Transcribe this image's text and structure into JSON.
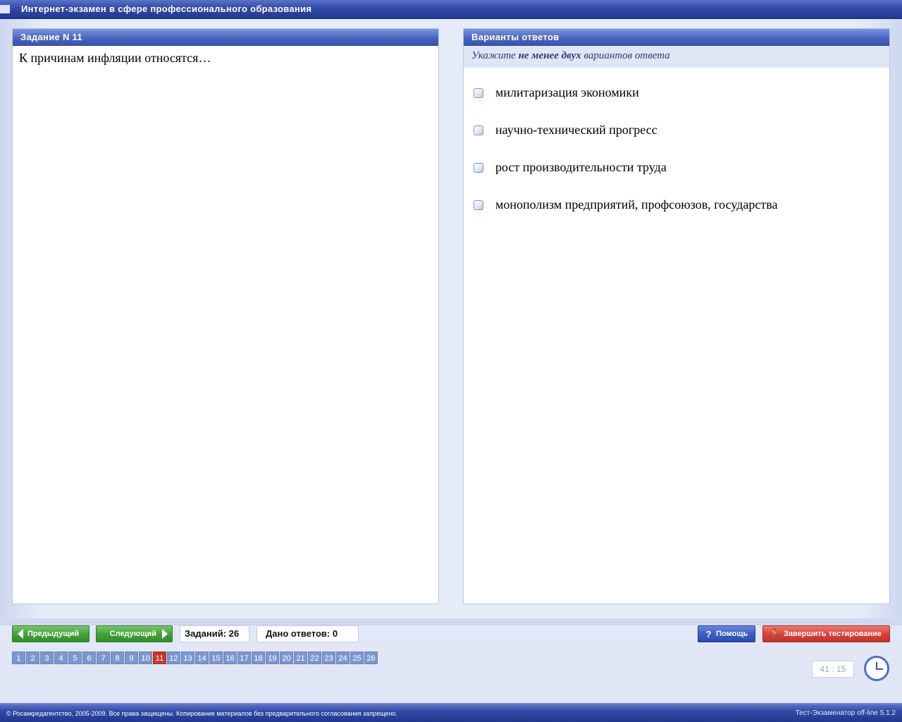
{
  "window": {
    "title": "Интернет-экзамен в сфере профессионального образования"
  },
  "task": {
    "header": "Задание N 11",
    "question": "К причинам инфляции относятся…"
  },
  "answers": {
    "header": "Варианты ответов",
    "hint_prefix": "Укажите ",
    "hint_bold": "не менее двух",
    "hint_suffix": " вариантов ответа",
    "options": [
      "милитаризация экономики",
      "научно-технический прогресс",
      "рост производительности труда",
      "монополизм предприятий, профсоюзов, государства"
    ]
  },
  "nav": {
    "prev_label": "Предыдущий",
    "next_label": "Следующий",
    "tasks_count": "Заданий: 26",
    "answers_given": "Дано ответов: 0",
    "help_label": "Помощь",
    "finish_label": "Завершить тестирование",
    "current_page": "11",
    "pages": [
      "1",
      "2",
      "3",
      "4",
      "5",
      "6",
      "7",
      "8",
      "9",
      "10",
      "11",
      "12",
      "13",
      "14",
      "15",
      "16",
      "17",
      "18",
      "19",
      "20",
      "21",
      "22",
      "23",
      "24",
      "25",
      "26"
    ],
    "timer": "41 : 15"
  },
  "footer": {
    "copyright": "© Росаккредагентство, 2005-2009. Все права защищены. Копирование материалов без предварительного согласования запрещено.",
    "version": "Тест-Экзаменатор off-line 5.1.2"
  },
  "colors": {
    "titlebar": "#3249a6",
    "panel_header": "#4a66c0",
    "current_page": "#c9372f",
    "page": "#7e96cf",
    "nav_button_green": "#45a23b",
    "help_button_blue": "#3b5ec6",
    "finish_button_red": "#d9443e"
  },
  "icons": {
    "prev": "arrow-left-icon",
    "next": "arrow-right-icon",
    "help": "question-icon",
    "finish": "running-man-icon",
    "clock": "clock-icon"
  }
}
